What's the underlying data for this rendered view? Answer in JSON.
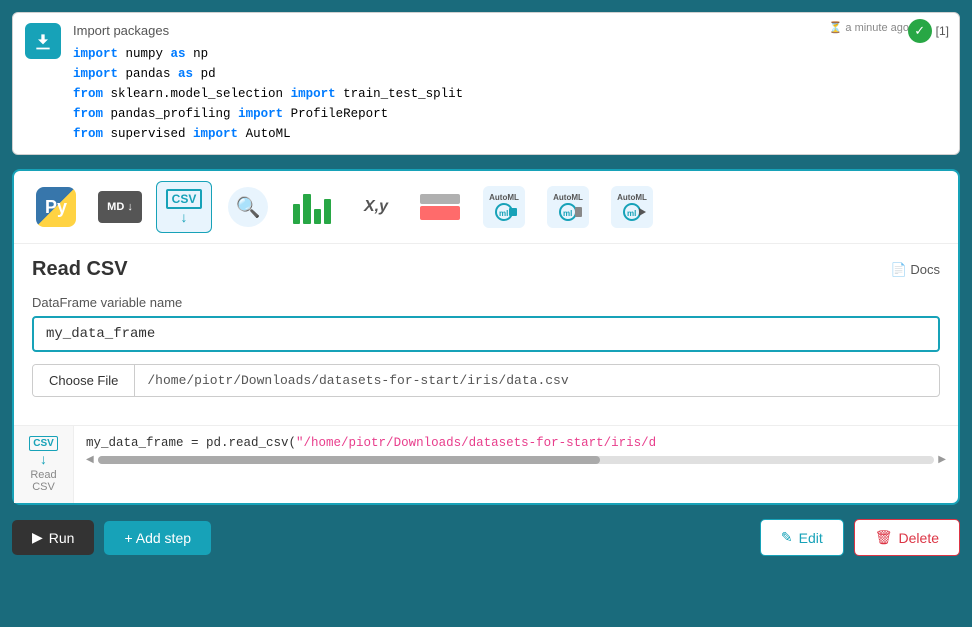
{
  "import_cell": {
    "label": "Import packages",
    "timestamp": "a minute ago",
    "badge": "[1]",
    "code_lines": [
      {
        "parts": [
          {
            "type": "kw",
            "text": "import"
          },
          {
            "type": "normal",
            "text": " numpy "
          },
          {
            "type": "kw",
            "text": "as"
          },
          {
            "type": "normal",
            "text": " np"
          }
        ]
      },
      {
        "parts": [
          {
            "type": "kw",
            "text": "import"
          },
          {
            "type": "normal",
            "text": " pandas "
          },
          {
            "type": "kw",
            "text": "as"
          },
          {
            "type": "normal",
            "text": " pd"
          }
        ]
      },
      {
        "parts": [
          {
            "type": "kw",
            "text": "from"
          },
          {
            "type": "normal",
            "text": " sklearn.model_selection "
          },
          {
            "type": "kw",
            "text": "import"
          },
          {
            "type": "normal",
            "text": " train_test_split"
          }
        ]
      },
      {
        "parts": [
          {
            "type": "kw",
            "text": "from"
          },
          {
            "type": "normal",
            "text": " pandas_profiling "
          },
          {
            "type": "kw",
            "text": "import"
          },
          {
            "type": "normal",
            "text": " ProfileReport"
          }
        ]
      },
      {
        "parts": [
          {
            "type": "kw",
            "text": "from"
          },
          {
            "type": "normal",
            "text": " supervised "
          },
          {
            "type": "kw",
            "text": "import"
          },
          {
            "type": "normal",
            "text": " AutoML"
          }
        ]
      }
    ]
  },
  "toolbar": {
    "icons": [
      {
        "name": "python",
        "label": "Python"
      },
      {
        "name": "markdown",
        "label": "MD"
      },
      {
        "name": "csv",
        "label": "CSV",
        "active": true
      },
      {
        "name": "search",
        "label": "Search"
      },
      {
        "name": "chart",
        "label": "Chart"
      },
      {
        "name": "xy",
        "label": "X,y"
      },
      {
        "name": "table",
        "label": "Table"
      },
      {
        "name": "automl1",
        "label": "AutoML"
      },
      {
        "name": "automl2",
        "label": "AutoML"
      },
      {
        "name": "automl3",
        "label": "AutoML"
      }
    ]
  },
  "read_csv": {
    "title": "Read CSV",
    "docs_label": "Docs",
    "field_label": "DataFrame variable name",
    "var_value": "my_data_frame",
    "choose_file_label": "Choose File",
    "file_path": "/home/piotr/Downloads/datasets-for-start/iris/data.csv",
    "code_line": "my_data_frame = pd.read_csv(\"/home/piotr/Downloads/datasets-for-start/iris/d",
    "step_label": "Read CSV"
  },
  "buttons": {
    "run": "Run",
    "add_step": "+ Add step",
    "edit": "Edit",
    "delete": "Delete"
  }
}
